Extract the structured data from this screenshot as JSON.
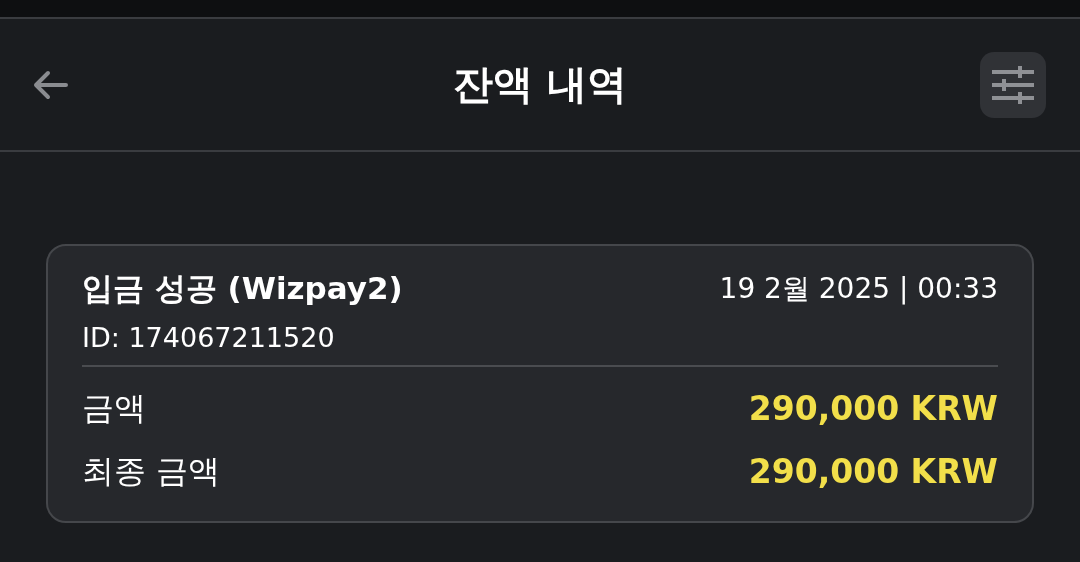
{
  "header": {
    "title": "잔액 내역"
  },
  "transactions": [
    {
      "title": "입금 성공 (Wizpay2)",
      "date": "19 2월 2025 | 00:33",
      "id": "ID: 174067211520",
      "rows": [
        {
          "label": "금액",
          "value": "290,000 KRW"
        },
        {
          "label": "최종 금액",
          "value": "290,000 KRW"
        }
      ]
    }
  ]
}
